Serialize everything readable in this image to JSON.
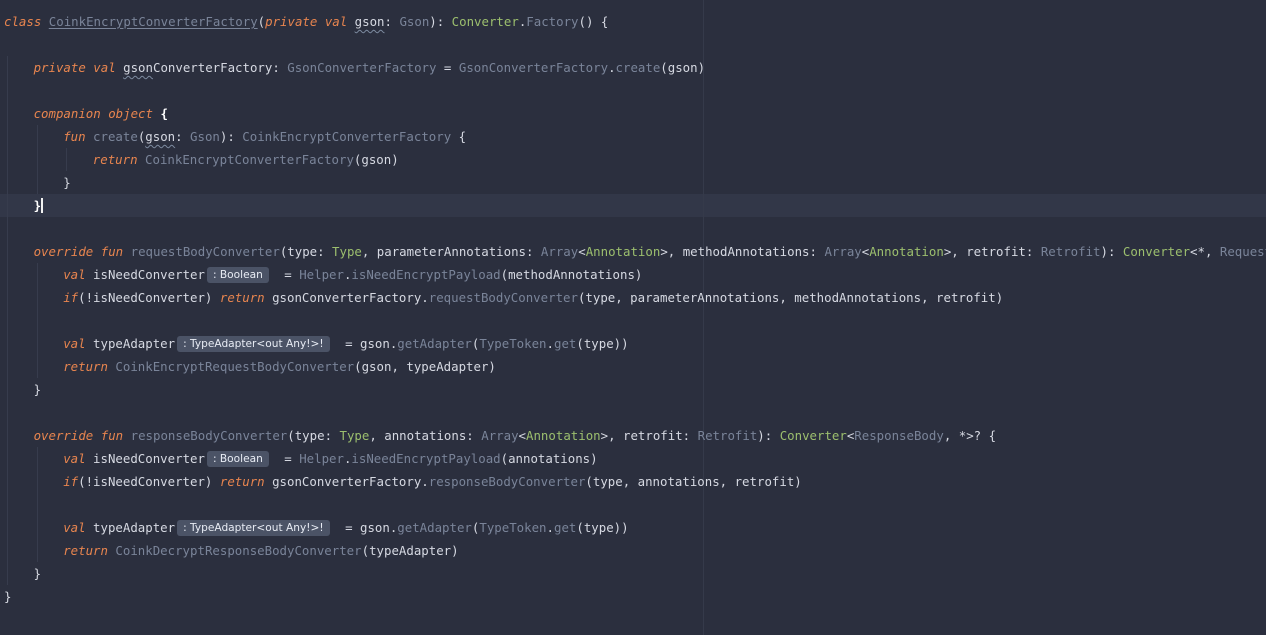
{
  "editor": {
    "language": "kotlin",
    "lines": [
      {
        "tokens": [
          {
            "t": "class",
            "k": "kw"
          },
          {
            "t": " ",
            "k": "sp"
          },
          {
            "t": "CoinkEncryptConverterFactory",
            "k": "cls-name"
          },
          {
            "t": "(",
            "k": "op"
          },
          {
            "t": "private",
            "k": "kw"
          },
          {
            "t": " ",
            "k": "sp"
          },
          {
            "t": "val",
            "k": "kw"
          },
          {
            "t": " ",
            "k": "sp"
          },
          {
            "t": "gson",
            "k": "id",
            "u": true
          },
          {
            "t": ": ",
            "k": "op"
          },
          {
            "t": "Gson",
            "k": "type"
          },
          {
            "t": "): ",
            "k": "op"
          },
          {
            "t": "Converter",
            "k": "tc"
          },
          {
            "t": ".",
            "k": "op"
          },
          {
            "t": "Factory",
            "k": "type"
          },
          {
            "t": "() {",
            "k": "op"
          }
        ]
      },
      {
        "tokens": []
      },
      {
        "indent": 1,
        "tokens": [
          {
            "t": "private",
            "k": "kw"
          },
          {
            "t": " ",
            "k": "sp"
          },
          {
            "t": "val",
            "k": "kw"
          },
          {
            "t": " ",
            "k": "sp"
          },
          {
            "t": "gson",
            "k": "id",
            "u": true
          },
          {
            "t": "ConverterFactory",
            "k": "id"
          },
          {
            "t": ": ",
            "k": "op"
          },
          {
            "t": "GsonConverterFactory",
            "k": "type"
          },
          {
            "t": " = ",
            "k": "op"
          },
          {
            "t": "GsonConverterFactory",
            "k": "type"
          },
          {
            "t": ".",
            "k": "op"
          },
          {
            "t": "create",
            "k": "fn"
          },
          {
            "t": "(gson)",
            "k": "op"
          }
        ]
      },
      {
        "tokens": []
      },
      {
        "indent": 1,
        "tokens": [
          {
            "t": "companion",
            "k": "kw"
          },
          {
            "t": " ",
            "k": "sp"
          },
          {
            "t": "object",
            "k": "kw"
          },
          {
            "t": " ",
            "k": "sp"
          },
          {
            "t": "{",
            "k": "bold"
          }
        ]
      },
      {
        "indent": 2,
        "tokens": [
          {
            "t": "fun",
            "k": "kw"
          },
          {
            "t": " ",
            "k": "sp"
          },
          {
            "t": "create",
            "k": "fn"
          },
          {
            "t": "(",
            "k": "op"
          },
          {
            "t": "gson",
            "k": "id",
            "u": true
          },
          {
            "t": ": ",
            "k": "op"
          },
          {
            "t": "Gson",
            "k": "type"
          },
          {
            "t": "): ",
            "k": "op"
          },
          {
            "t": "CoinkEncryptConverterFactory",
            "k": "type"
          },
          {
            "t": " {",
            "k": "op"
          }
        ]
      },
      {
        "indent": 3,
        "tokens": [
          {
            "t": "return",
            "k": "kw"
          },
          {
            "t": " ",
            "k": "sp"
          },
          {
            "t": "CoinkEncryptConverterFactory",
            "k": "type"
          },
          {
            "t": "(gson)",
            "k": "op"
          }
        ]
      },
      {
        "indent": 2,
        "tokens": [
          {
            "t": "}",
            "k": "op"
          }
        ]
      },
      {
        "indent": 1,
        "current": true,
        "tokens": [
          {
            "t": "}",
            "k": "bold"
          },
          {
            "t": "",
            "k": "caret"
          }
        ]
      },
      {
        "tokens": []
      },
      {
        "indent": 1,
        "tokens": [
          {
            "t": "override",
            "k": "kw"
          },
          {
            "t": " ",
            "k": "sp"
          },
          {
            "t": "fun",
            "k": "kw"
          },
          {
            "t": " ",
            "k": "sp"
          },
          {
            "t": "requestBodyConverter",
            "k": "fn"
          },
          {
            "t": "(type: ",
            "k": "op"
          },
          {
            "t": "Type",
            "k": "tc"
          },
          {
            "t": ", parameterAnnotations: ",
            "k": "op"
          },
          {
            "t": "Array",
            "k": "type"
          },
          {
            "t": "<",
            "k": "op"
          },
          {
            "t": "Annotation",
            "k": "tc"
          },
          {
            "t": ">, methodAnnotations: ",
            "k": "op"
          },
          {
            "t": "Array",
            "k": "type"
          },
          {
            "t": "<",
            "k": "op"
          },
          {
            "t": "Annotation",
            "k": "tc"
          },
          {
            "t": ">, retrofit: ",
            "k": "op"
          },
          {
            "t": "Retrofit",
            "k": "type"
          },
          {
            "t": "): ",
            "k": "op"
          },
          {
            "t": "Converter",
            "k": "tc"
          },
          {
            "t": "<*, ",
            "k": "op"
          },
          {
            "t": "RequestBody",
            "k": "type"
          },
          {
            "t": ">? {",
            "k": "op"
          }
        ]
      },
      {
        "indent": 2,
        "tokens": [
          {
            "t": "val",
            "k": "kw"
          },
          {
            "t": " ",
            "k": "sp"
          },
          {
            "t": "isNeedConverter",
            "k": "id"
          },
          {
            "t": ": Boolean",
            "k": "hint"
          },
          {
            "t": " = ",
            "k": "op"
          },
          {
            "t": "Helper",
            "k": "type"
          },
          {
            "t": ".",
            "k": "op"
          },
          {
            "t": "isNeedEncryptPayload",
            "k": "fn"
          },
          {
            "t": "(methodAnnotations)",
            "k": "op"
          }
        ]
      },
      {
        "indent": 2,
        "tokens": [
          {
            "t": "if",
            "k": "kw"
          },
          {
            "t": "(!isNeedConverter) ",
            "k": "op"
          },
          {
            "t": "return",
            "k": "kw"
          },
          {
            "t": " gsonConverterFactory.",
            "k": "op"
          },
          {
            "t": "requestBodyConverter",
            "k": "fn"
          },
          {
            "t": "(type, parameterAnnotations, methodAnnotations, retrofit)",
            "k": "op"
          }
        ]
      },
      {
        "tokens": []
      },
      {
        "indent": 2,
        "tokens": [
          {
            "t": "val",
            "k": "kw"
          },
          {
            "t": " ",
            "k": "sp"
          },
          {
            "t": "typeAdapter",
            "k": "id"
          },
          {
            "t": ": TypeAdapter<out Any!>!",
            "k": "hint"
          },
          {
            "t": " = gson.",
            "k": "op"
          },
          {
            "t": "getAdapter",
            "k": "fn"
          },
          {
            "t": "(",
            "k": "op"
          },
          {
            "t": "TypeToken",
            "k": "type"
          },
          {
            "t": ".",
            "k": "op"
          },
          {
            "t": "get",
            "k": "fn"
          },
          {
            "t": "(type))",
            "k": "op"
          }
        ]
      },
      {
        "indent": 2,
        "tokens": [
          {
            "t": "return",
            "k": "kw"
          },
          {
            "t": " ",
            "k": "sp"
          },
          {
            "t": "CoinkEncryptRequestBodyConverter",
            "k": "type"
          },
          {
            "t": "(gson, typeAdapter)",
            "k": "op"
          }
        ]
      },
      {
        "indent": 1,
        "tokens": [
          {
            "t": "}",
            "k": "op"
          }
        ]
      },
      {
        "tokens": []
      },
      {
        "indent": 1,
        "tokens": [
          {
            "t": "override",
            "k": "kw"
          },
          {
            "t": " ",
            "k": "sp"
          },
          {
            "t": "fun",
            "k": "kw"
          },
          {
            "t": " ",
            "k": "sp"
          },
          {
            "t": "responseBodyConverter",
            "k": "fn"
          },
          {
            "t": "(type: ",
            "k": "op"
          },
          {
            "t": "Type",
            "k": "tc"
          },
          {
            "t": ", annotations: ",
            "k": "op"
          },
          {
            "t": "Array",
            "k": "type"
          },
          {
            "t": "<",
            "k": "op"
          },
          {
            "t": "Annotation",
            "k": "tc"
          },
          {
            "t": ">, retrofit: ",
            "k": "op"
          },
          {
            "t": "Retrofit",
            "k": "type"
          },
          {
            "t": "): ",
            "k": "op"
          },
          {
            "t": "Converter",
            "k": "tc"
          },
          {
            "t": "<",
            "k": "op"
          },
          {
            "t": "ResponseBody",
            "k": "type"
          },
          {
            "t": ", *>? {",
            "k": "op"
          }
        ]
      },
      {
        "indent": 2,
        "tokens": [
          {
            "t": "val",
            "k": "kw"
          },
          {
            "t": " ",
            "k": "sp"
          },
          {
            "t": "isNeedConverter",
            "k": "id"
          },
          {
            "t": ": Boolean",
            "k": "hint"
          },
          {
            "t": " = ",
            "k": "op"
          },
          {
            "t": "Helper",
            "k": "type"
          },
          {
            "t": ".",
            "k": "op"
          },
          {
            "t": "isNeedEncryptPayload",
            "k": "fn"
          },
          {
            "t": "(annotations)",
            "k": "op"
          }
        ]
      },
      {
        "indent": 2,
        "tokens": [
          {
            "t": "if",
            "k": "kw"
          },
          {
            "t": "(!isNeedConverter) ",
            "k": "op"
          },
          {
            "t": "return",
            "k": "kw"
          },
          {
            "t": " gsonConverterFactory.",
            "k": "op"
          },
          {
            "t": "responseBodyConverter",
            "k": "fn"
          },
          {
            "t": "(type, annotations, retrofit)",
            "k": "op"
          }
        ]
      },
      {
        "tokens": []
      },
      {
        "indent": 2,
        "tokens": [
          {
            "t": "val",
            "k": "kw"
          },
          {
            "t": " ",
            "k": "sp"
          },
          {
            "t": "typeAdapter",
            "k": "id"
          },
          {
            "t": ": TypeAdapter<out Any!>!",
            "k": "hint"
          },
          {
            "t": " = gson.",
            "k": "op"
          },
          {
            "t": "getAdapter",
            "k": "fn"
          },
          {
            "t": "(",
            "k": "op"
          },
          {
            "t": "TypeToken",
            "k": "type"
          },
          {
            "t": ".",
            "k": "op"
          },
          {
            "t": "get",
            "k": "fn"
          },
          {
            "t": "(type))",
            "k": "op"
          }
        ]
      },
      {
        "indent": 2,
        "tokens": [
          {
            "t": "return",
            "k": "kw"
          },
          {
            "t": " ",
            "k": "sp"
          },
          {
            "t": "CoinkDecryptResponseBodyConverter",
            "k": "type"
          },
          {
            "t": "(typeAdapter)",
            "k": "op"
          }
        ]
      },
      {
        "indent": 1,
        "tokens": [
          {
            "t": "}",
            "k": "op"
          }
        ]
      },
      {
        "tokens": [
          {
            "t": "}",
            "k": "op"
          }
        ]
      }
    ]
  },
  "colors": {
    "background": "#2b2f3e",
    "keyword": "#e8854f",
    "identifier": "#d6d9e2",
    "type_dim": "#7a8499",
    "type_green": "#9cbf6e",
    "hint_bg": "#4b5366",
    "current_line": "#323748"
  }
}
